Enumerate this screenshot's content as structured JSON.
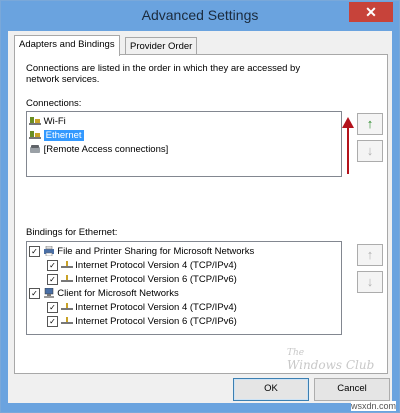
{
  "window": {
    "title": "Advanced Settings",
    "close_glyph": "✕"
  },
  "tabs": [
    {
      "label": "Adapters and Bindings",
      "active": true
    },
    {
      "label": "Provider Order",
      "active": false
    }
  ],
  "description": "Connections are listed in the order in which they are accessed by network services.",
  "connections": {
    "label": "Connections:",
    "items": [
      {
        "label": "Wi-Fi",
        "icon": "network-adapter-icon",
        "selected": false
      },
      {
        "label": "Ethernet",
        "icon": "network-adapter-icon",
        "selected": true
      },
      {
        "label": "[Remote Access connections]",
        "icon": "phone-modem-icon",
        "selected": false
      }
    ],
    "move_up_glyph": "↑",
    "move_down_glyph": "↓"
  },
  "bindings": {
    "label": "Bindings for Ethernet:",
    "items": [
      {
        "label": "File and Printer Sharing for Microsoft Networks",
        "level": 0,
        "checked": true,
        "icon": "printer-sharing-icon"
      },
      {
        "label": "Internet Protocol Version 4 (TCP/IPv4)",
        "level": 1,
        "checked": true,
        "icon": "protocol-icon"
      },
      {
        "label": "Internet Protocol Version 6 (TCP/IPv6)",
        "level": 1,
        "checked": true,
        "icon": "protocol-icon"
      },
      {
        "label": "Client for Microsoft Networks",
        "level": 0,
        "checked": true,
        "icon": "network-client-icon"
      },
      {
        "label": "Internet Protocol Version 4 (TCP/IPv4)",
        "level": 1,
        "checked": true,
        "icon": "protocol-icon"
      },
      {
        "label": "Internet Protocol Version 6 (TCP/IPv6)",
        "level": 1,
        "checked": true,
        "icon": "protocol-icon"
      }
    ],
    "move_up_glyph": "↑",
    "move_down_glyph": "↓"
  },
  "watermark": {
    "line1": "The",
    "line2": "Windows Club"
  },
  "footer": {
    "ok_label": "OK",
    "cancel_label": "Cancel"
  },
  "site_watermark": "wsxdn.com",
  "colors": {
    "title_bar": "#6aa3df",
    "selection": "#3399ff",
    "arrow_annotation": "#b3121c",
    "move_up_enabled": "#2a8a2a"
  }
}
